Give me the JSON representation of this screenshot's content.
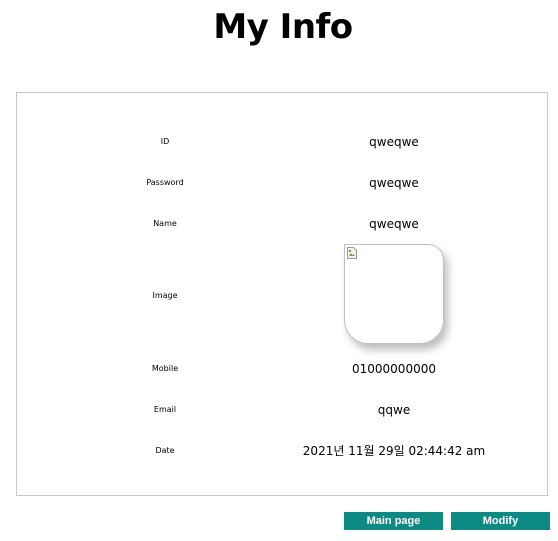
{
  "title": "My Info",
  "rows": [
    {
      "label": "ID",
      "value": "qweqwe"
    },
    {
      "label": "Password",
      "value": "qweqwe"
    },
    {
      "label": "Name",
      "value": "qweqwe"
    },
    {
      "label": "Image",
      "value": ""
    },
    {
      "label": "Mobile",
      "value": "01000000000"
    },
    {
      "label": "Email",
      "value": "qqwe"
    },
    {
      "label": "Date",
      "value": "2021년 11월 29일 02:44:42 am"
    }
  ],
  "image": {
    "icon": "broken-image-icon"
  },
  "buttons": {
    "main_page": "Main page",
    "modify": "Modify"
  },
  "colors": {
    "button_bg": "#0e8a84",
    "button_text": "#ffffff",
    "box_border": "#c8c8c8"
  }
}
